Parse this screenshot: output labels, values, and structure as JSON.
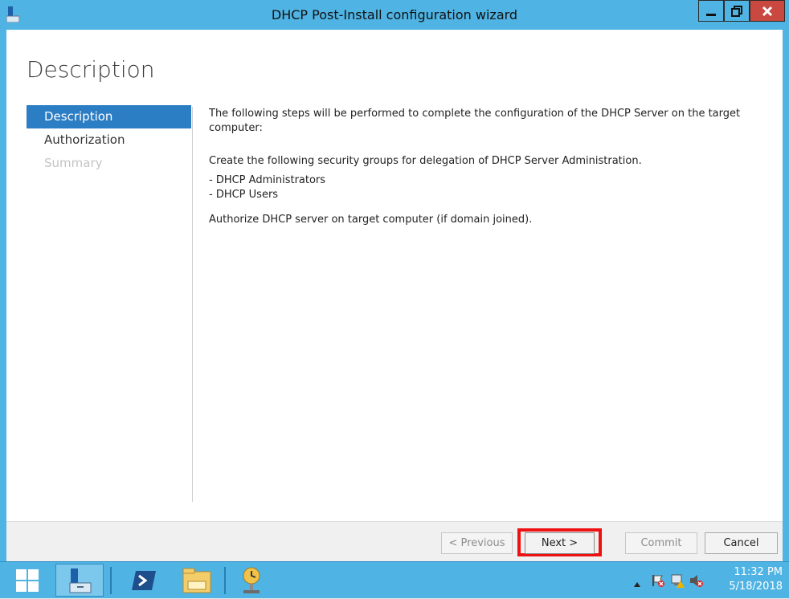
{
  "window": {
    "title": "DHCP Post-Install configuration wizard"
  },
  "page": {
    "heading": "Description"
  },
  "nav": {
    "items": [
      {
        "label": "Description",
        "state": "active"
      },
      {
        "label": "Authorization",
        "state": "normal"
      },
      {
        "label": "Summary",
        "state": "disabled"
      }
    ]
  },
  "content": {
    "intro": "The following steps will be performed to complete the configuration of the DHCP Server on the target computer:",
    "groups_heading": "Create the following security groups for delegation of DHCP Server Administration.",
    "groups": [
      "- DHCP Administrators",
      "- DHCP Users"
    ],
    "authorize": "Authorize DHCP server on target computer (if domain joined)."
  },
  "footer": {
    "previous_label": "< Previous",
    "next_label": "Next >",
    "commit_label": "Commit",
    "cancel_label": "Cancel"
  },
  "taskbar": {
    "time": "11:32 PM",
    "date": "5/18/2018",
    "items": [
      "start-icon",
      "server-manager-icon",
      "powershell-icon",
      "file-explorer-icon",
      "tools-icon"
    ]
  },
  "colors": {
    "accent": "#4fb3e3",
    "nav_active": "#2b7dc4",
    "close": "#c9483f",
    "highlight": "#ee1111"
  }
}
